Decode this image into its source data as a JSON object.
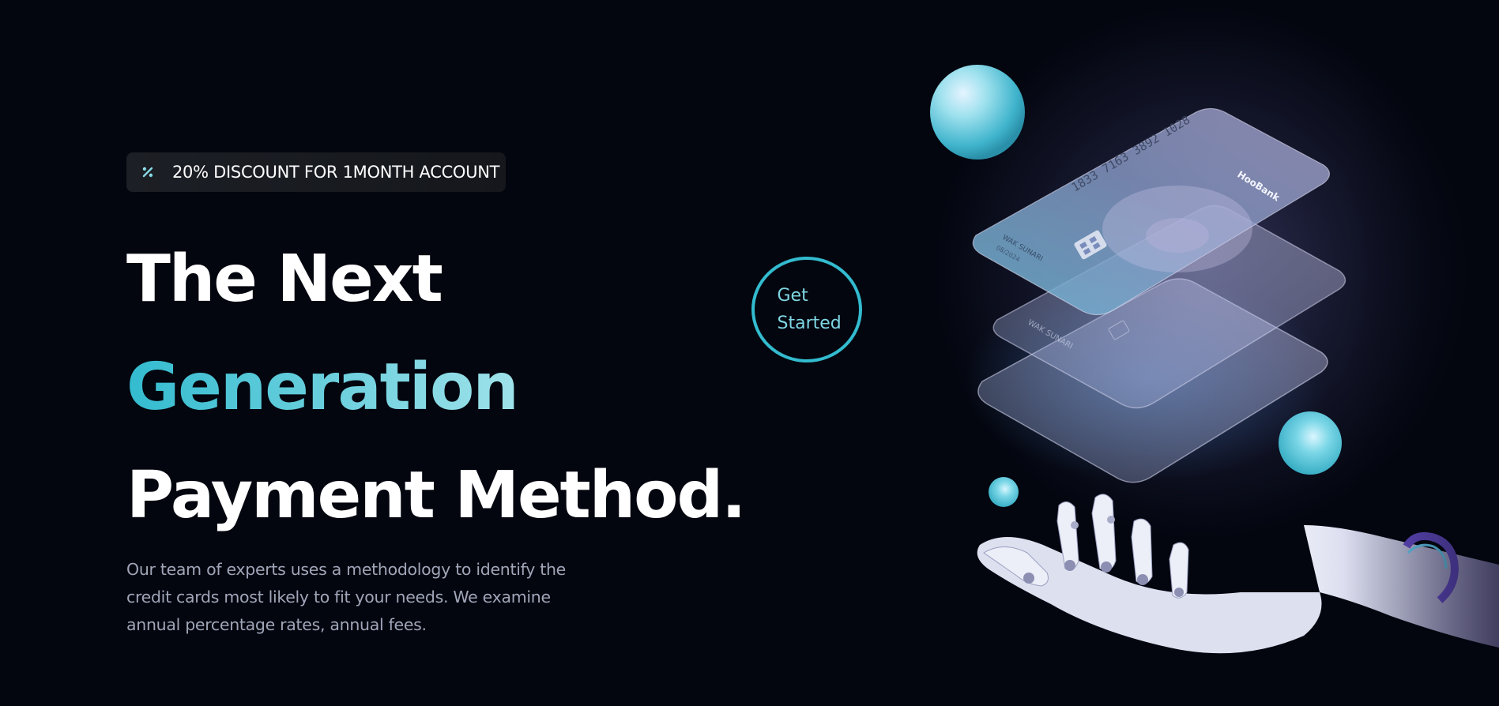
{
  "promo": {
    "discount_text": "20% DISCOUNT FOR 1MONTH ACCOUNT",
    "icon": "discount-icon"
  },
  "hero": {
    "headline_line1": "The Next",
    "headline_line2": "Generation",
    "headline_line3": "Payment Method.",
    "description": "Our team of experts uses a methodology to identify the credit cards most likely to fit your needs. We examine annual percentage rates, annual fees."
  },
  "cta": {
    "label": "Get Started"
  },
  "cards": {
    "top_number": "1833 7163 3892 1028",
    "brand": "HooBank",
    "holder": "WAK SUNARI",
    "expiry": "08/2024"
  },
  "colors": {
    "background": "#03060f",
    "accent": "#33bbcf",
    "accent_light": "#def9fa",
    "text_primary": "#ffffff",
    "text_secondary": "#a0a6b8"
  }
}
